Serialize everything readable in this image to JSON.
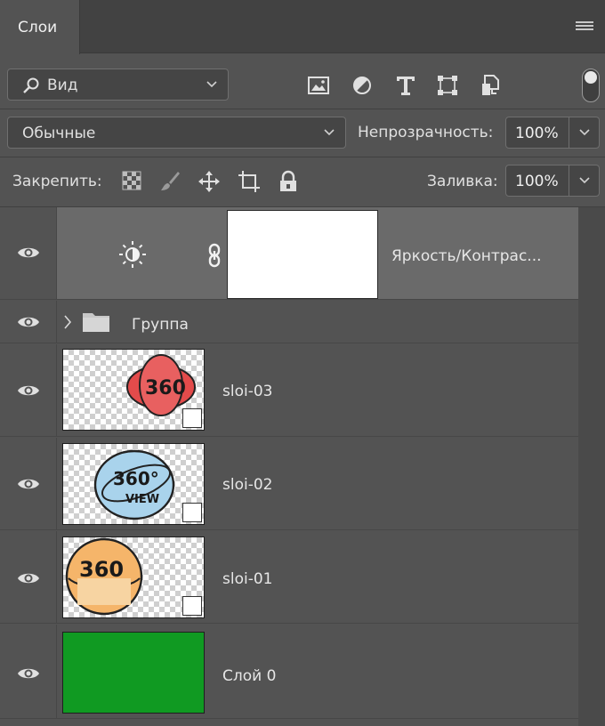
{
  "panel": {
    "tab_label": "Слои"
  },
  "filter": {
    "kind_label": "Вид",
    "icons": [
      "image-filter-icon",
      "adjustment-filter-icon",
      "text-filter-icon",
      "shape-filter-icon",
      "smart-object-filter-icon"
    ]
  },
  "blend": {
    "mode": "Обычные",
    "opacity_label": "Непрозрачность:",
    "opacity_value": "100%"
  },
  "lock": {
    "label": "Закрепить:",
    "fill_label": "Заливка:",
    "fill_value": "100%"
  },
  "layers": [
    {
      "name": "Яркость/Контрас...",
      "type": "adjustment",
      "selected": true
    },
    {
      "name": "Группа",
      "type": "group"
    },
    {
      "name": "sloi-03",
      "type": "smart-object",
      "art_text": "360",
      "art_color": "#e34b4b"
    },
    {
      "name": "sloi-02",
      "type": "smart-object",
      "art_text": "360°",
      "art_subtext": "VIEW",
      "art_color": "#a9d3ec"
    },
    {
      "name": "sloi-01",
      "type": "smart-object",
      "art_text": "360",
      "art_color": "#f5b56a"
    },
    {
      "name": "Слой 0",
      "type": "fill",
      "fill_color": "#109a22"
    }
  ],
  "colors": {
    "panel_bg": "#535353",
    "header_bg": "#424242",
    "selected_row": "#6a6a6a",
    "field_bg": "#454545"
  }
}
